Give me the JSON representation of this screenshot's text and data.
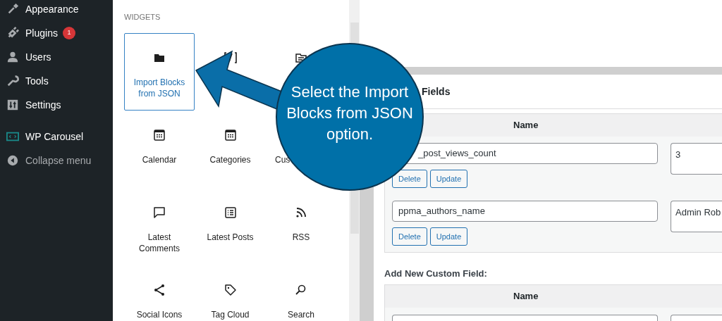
{
  "sidebar": {
    "items": [
      {
        "label": "Appearance"
      },
      {
        "label": "Plugins",
        "badge": "1"
      },
      {
        "label": "Users"
      },
      {
        "label": "Tools"
      },
      {
        "label": "Settings"
      }
    ],
    "extra_items": [
      {
        "label": "WP Carousel"
      },
      {
        "label": "Collapse menu",
        "kind": "collapse"
      }
    ]
  },
  "inserter": {
    "heading": "WIDGETS",
    "blocks": [
      {
        "label": "Import Blocks from JSON",
        "selected": true
      },
      {
        "selected": false
      },
      {
        "selected": false
      },
      {
        "label": "Calendar",
        "selected": false
      },
      {
        "label": "Categories",
        "selected": false
      },
      {
        "label": "Cus",
        "kind": "partly_hidden",
        "selected": false
      },
      {
        "label": "Latest Comments",
        "selected": false
      },
      {
        "label": "Latest Posts",
        "selected": false
      },
      {
        "label": "RSS",
        "selected": false
      },
      {
        "label": "Social Icons",
        "selected": false
      },
      {
        "label": "Tag Cloud",
        "selected": false
      },
      {
        "label": "Search",
        "selected": false
      }
    ]
  },
  "custom_fields": {
    "title": "Fields",
    "column": "Name",
    "rows": [
      {
        "name": "_post_views_count",
        "kind": "partly_hidden",
        "value": "3",
        "buttons": [
          "Delete",
          "Update"
        ]
      },
      {
        "name": "ppma_authors_name",
        "value": "Admin Rob",
        "buttons": [
          "Delete",
          "Update"
        ]
      }
    ],
    "add_heading": "Add New Custom Field:",
    "add_column": "Name"
  },
  "callout": {
    "text": "Select the Import Blocks from JSON option."
  }
}
